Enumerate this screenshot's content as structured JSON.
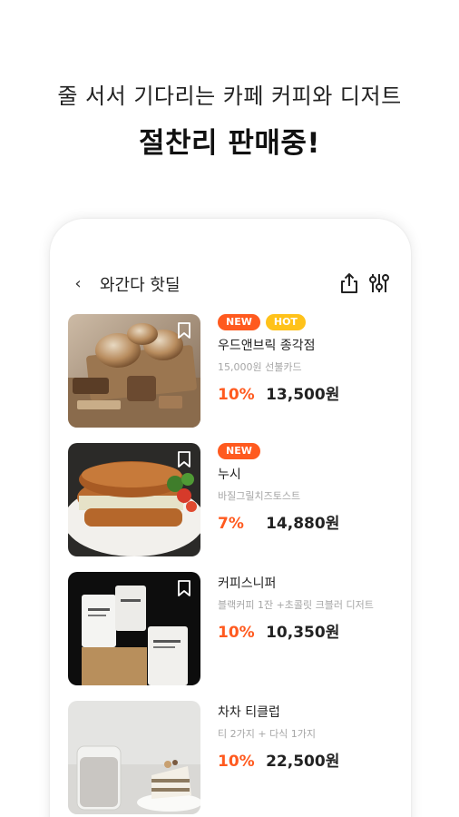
{
  "promo": {
    "line1": "줄 서서 기다리는 카페 커피와 디저트",
    "line2": "절찬리 판매중!"
  },
  "app_bar": {
    "back_icon": "chevron-left-icon",
    "title": "와간다 핫딜",
    "share_icon": "share-icon",
    "filter_icon": "filter-icon"
  },
  "colors": {
    "accent": "#ff5a1f",
    "hot": "#ffc21a",
    "muted": "#a6a6a6"
  },
  "products": [
    {
      "badges": [
        "NEW",
        "HOT"
      ],
      "name": "우드앤브릭 종각점",
      "desc": "15,000원 선불카드",
      "discount": "10%",
      "price": "13,500원",
      "image": "bread-loaves-photo"
    },
    {
      "badges": [
        "NEW"
      ],
      "name": "누시",
      "desc": "바질그릴치즈토스트",
      "discount": "7%",
      "price": "14,880원",
      "image": "toast-sandwich-photo"
    },
    {
      "badges": [],
      "name": "커피스니퍼",
      "desc": "블랙커피 1잔 +초콜릿 크블러 디저트",
      "discount": "10%",
      "price": "10,350원",
      "image": "coffee-bags-photo"
    },
    {
      "badges": [],
      "name": "차차 티클럽",
      "desc": "티 2가지 + 다식 1가지",
      "discount": "10%",
      "price": "22,500원",
      "image": "tea-and-cake-photo"
    }
  ]
}
